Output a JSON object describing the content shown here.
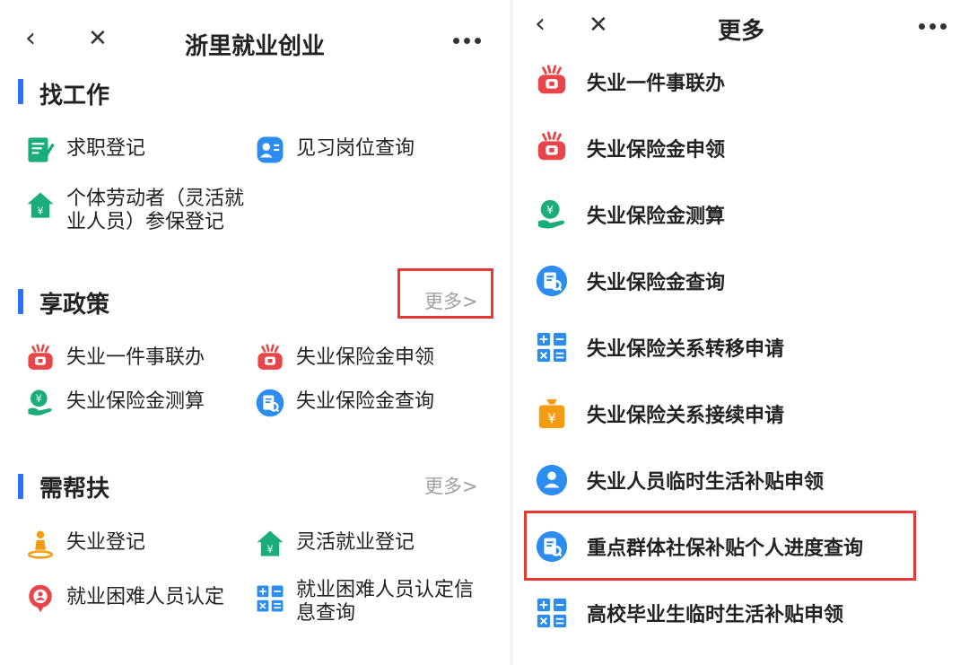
{
  "left": {
    "nav": {
      "back": "‹",
      "close": "✕",
      "title": "浙里就业创业"
    },
    "sections": [
      {
        "title": "找工作",
        "items": [
          {
            "label": "求职登记",
            "icon": "register-form-icon"
          },
          {
            "label": "见习岗位查询",
            "icon": "person-card-icon"
          },
          {
            "label": "个体劳动者（灵活就业人员）参保登记",
            "icon": "house-yuan-icon"
          }
        ]
      },
      {
        "title": "享政策",
        "more": "更多>",
        "items": [
          {
            "label": "失业一件事联办",
            "icon": "handshake-icon"
          },
          {
            "label": "失业保险金申领",
            "icon": "handshake-icon"
          },
          {
            "label": "失业保险金测算",
            "icon": "money-hand-icon"
          },
          {
            "label": "失业保险金查询",
            "icon": "document-search-icon"
          }
        ]
      },
      {
        "title": "需帮扶",
        "more": "更多>",
        "items": [
          {
            "label": "失业登记",
            "icon": "person-pin-icon"
          },
          {
            "label": "灵活就业登记",
            "icon": "house-yuan-icon"
          },
          {
            "label": "就业困难人员认定",
            "icon": "badge-person-icon"
          },
          {
            "label": "就业困难人员认定信息查询",
            "icon": "calculator-grid-icon"
          }
        ]
      }
    ]
  },
  "right": {
    "nav": {
      "back": "‹",
      "close": "✕",
      "title": "更多"
    },
    "items": [
      {
        "label": "失业一件事联办",
        "icon": "handshake-icon"
      },
      {
        "label": "失业保险金申领",
        "icon": "handshake-icon"
      },
      {
        "label": "失业保险金测算",
        "icon": "money-hand-icon"
      },
      {
        "label": "失业保险金查询",
        "icon": "document-search-icon"
      },
      {
        "label": "失业保险关系转移申请",
        "icon": "calculator-grid-icon"
      },
      {
        "label": "失业保险关系接续申请",
        "icon": "yuan-bag-icon"
      },
      {
        "label": "失业人员临时生活补贴申领",
        "icon": "person-circle-icon"
      },
      {
        "label": "重点群体社保补贴个人进度查询",
        "icon": "document-search-icon"
      },
      {
        "label": "高校毕业生临时生活补贴申领",
        "icon": "calculator-grid-icon"
      }
    ]
  },
  "colors": {
    "accent": "#2d6ff7",
    "highlight": "#e53935",
    "icon_red": "#e8454a",
    "icon_green": "#1aad7a"
  }
}
